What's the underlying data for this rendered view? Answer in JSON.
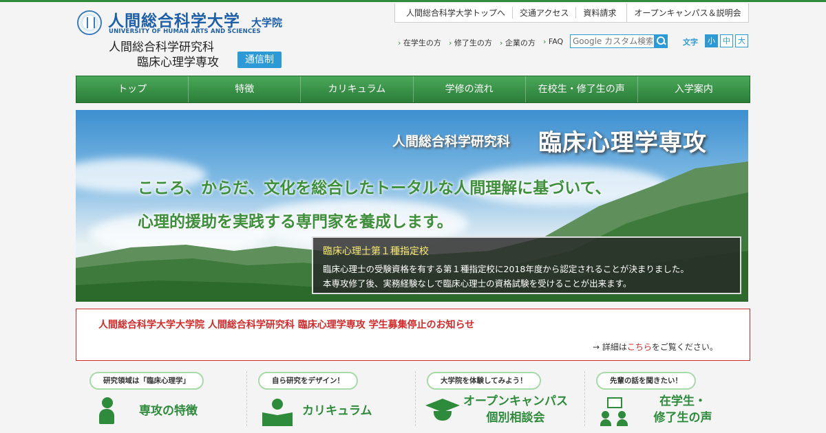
{
  "header": {
    "university_name": "人間総合科学大学",
    "graduate_label": "大学院",
    "university_en": "UNIVERSITY OF HUMAN ARTS AND SCIENCES",
    "department_line1": "人間総合科学研究科",
    "department_line2": "臨床心理学専攻",
    "tsushin_badge": "通信制"
  },
  "top_links": [
    "人間総合科学大学トップへ",
    "交通アクセス",
    "資料請求"
  ],
  "open_campus_link": "オープンキャンパス＆説明会",
  "sub_links": [
    "在学生の方",
    "修了生の方",
    "企業の方",
    "FAQ"
  ],
  "search": {
    "placeholder": "Google カスタム検索"
  },
  "font_size": {
    "label": "文字",
    "options": [
      "小",
      "中",
      "大"
    ],
    "selected": "小"
  },
  "nav": [
    "トップ",
    "特徴",
    "カリキュラム",
    "学修の流れ",
    "在校生・修了生の声",
    "入学案内"
  ],
  "hero": {
    "sub_title": "人間総合科学研究科",
    "main_title": "臨床心理学専攻",
    "line1": "こころ、からだ、文化を総合したトータルな人間理解に基づいて、",
    "line2": "心理的援助を実践する専門家を養成します。",
    "notice_title": "臨床心理士第１種指定校",
    "notice_text1": "臨床心理士の受験資格を有する第１種指定校に2018年度から認定されることが決まりました。",
    "notice_text2": "本専攻修了後、実務経験なしで臨床心理士の資格試験を受けることが出来ます。"
  },
  "alert": {
    "title": "人間総合科学大学大学院 人間総合科学研究科 臨床心理学専攻 学生募集停止のお知らせ",
    "detail_prefix": "→ 詳細は",
    "detail_link": "こちら",
    "detail_suffix": "をご覧ください。"
  },
  "features": [
    {
      "bubble": "研究領域は「臨床心理学」",
      "title": "専攻の特徴",
      "icon": "thinker-icon"
    },
    {
      "bubble": "自ら研究をデザイン！",
      "title": "カリキュラム",
      "icon": "reader-icon"
    },
    {
      "bubble": "大学院を体験してみよう！",
      "title_line1": "オープンキャンパス",
      "title_line2": "個別相談会",
      "icon": "graduation-cap-icon"
    },
    {
      "bubble": "先輩の話を聞きたい！",
      "title_line1": "在学生・",
      "title_line2": "修了生の声",
      "icon": "students-icon"
    }
  ],
  "colors": {
    "brand_green": "#2e8b3c",
    "brand_blue": "#2b9ad6",
    "alert_red": "#d12a2a"
  }
}
